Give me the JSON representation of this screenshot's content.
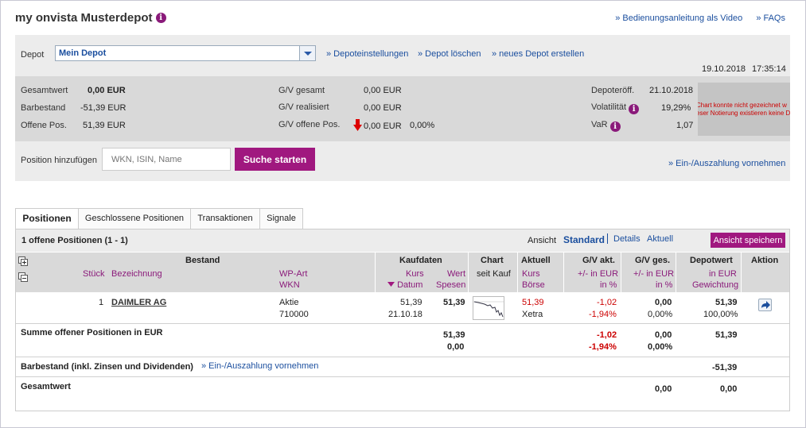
{
  "header": {
    "title": "my onvista Musterdepot",
    "video_link": "» Bedienungsanleitung als Video",
    "faq_link": "» FAQs"
  },
  "depot_bar": {
    "label": "Depot",
    "selected": "Mein Depot",
    "settings_link": "» Depoteinstellungen",
    "delete_link": "» Depot löschen",
    "new_link": "» neues Depot erstellen",
    "date": "19.10.2018",
    "time": "17:35:14"
  },
  "summary": {
    "gesamtwert_label": "Gesamtwert",
    "gesamtwert": "0,00 EUR",
    "barbestand_label": "Barbestand",
    "barbestand": "-51,39 EUR",
    "offene_label": "Offene Pos.",
    "offene": "51,39 EUR",
    "gv_gesamt_label": "G/V gesamt",
    "gv_gesamt": "0,00 EUR",
    "gv_real_label": "G/V realisiert",
    "gv_real": "0,00 EUR",
    "gv_offen_label": "G/V offene Pos.",
    "gv_offen": "0,00 EUR",
    "gv_offen_pct": "0,00%",
    "depoteroeff_label": "Depoteröff.",
    "depoteroeff": "21.10.2018",
    "volatilitaet_label": "Volatilität",
    "volatilitaet": "19,29%",
    "var_label": "VaR",
    "var": "1,07",
    "chart_msg_1": "Chart konnte nicht gezeichnet w",
    "chart_msg_2": "eser Notierung existieren keine D"
  },
  "add_position": {
    "label": "Position hinzufügen",
    "placeholder": "WKN, ISIN, Name",
    "button": "Suche starten",
    "payment_link": "» Ein-/Auszahlung vornehmen"
  },
  "tabs": [
    "Positionen",
    "Geschlossene Positionen",
    "Transaktionen",
    "Signale"
  ],
  "positions": {
    "count_label": "1 offene Positionen (1 - 1)",
    "view_label": "Ansicht",
    "view_standard": "Standard",
    "view_details": "Details",
    "view_aktuell": "Aktuell",
    "save_view": "Ansicht speichern",
    "headers": {
      "bestand": "Bestand",
      "stueck": "Stück",
      "bezeichnung": "Bezeichnung",
      "wpart": "WP-Art",
      "wkn": "WKN",
      "kaufdaten": "Kaufdaten",
      "kurs": "Kurs",
      "wert": "Wert",
      "datum": "Datum",
      "spesen": "Spesen",
      "chart": "Chart",
      "seit_kauf": "seit Kauf",
      "aktuell": "Aktuell",
      "akt_kurs": "Kurs",
      "boerse": "Börse",
      "gv_akt": "G/V akt.",
      "gv_akt_eur": "+/- in EUR",
      "gv_akt_pct": "in %",
      "gv_ges": "G/V ges.",
      "gv_ges_eur": "+/- in EUR",
      "gv_ges_pct": "in %",
      "depotwert": "Depotwert",
      "dw_eur": "in EUR",
      "gewichtung": "Gewichtung",
      "aktion": "Aktion"
    },
    "row": {
      "stueck": "1",
      "name": "DAIMLER AG",
      "wpart": "Aktie",
      "wkn": "710000",
      "kurs": "51,39",
      "wert": "51,39",
      "datum": "21.10.18",
      "akt_kurs": "51,39",
      "boerse": "Xetra",
      "gv_akt_eur": "-1,02",
      "gv_akt_pct": "-1,94%",
      "gv_ges_eur": "0,00",
      "gv_ges_pct": "0,00%",
      "depotwert": "51,39",
      "gewichtung": "100,00%"
    },
    "sum": {
      "label": "Summe offener Positionen in EUR",
      "wert": "51,39",
      "spesen": "0,00",
      "gv_akt_eur": "-1,02",
      "gv_akt_pct": "-1,94%",
      "gv_ges_eur": "0,00",
      "gv_ges_pct": "0,00%",
      "depotwert": "51,39"
    },
    "bar": {
      "label": "Barbestand (inkl. Zinsen und Dividenden)",
      "link": "» Ein-/Auszahlung vornehmen",
      "depotwert": "-51,39"
    },
    "total": {
      "label": "Gesamtwert",
      "gv_ges": "0,00",
      "depotwert": "0,00"
    }
  },
  "colors": {
    "accent": "#a0187f",
    "link": "#1a4e9e",
    "negative": "#cc0000"
  }
}
